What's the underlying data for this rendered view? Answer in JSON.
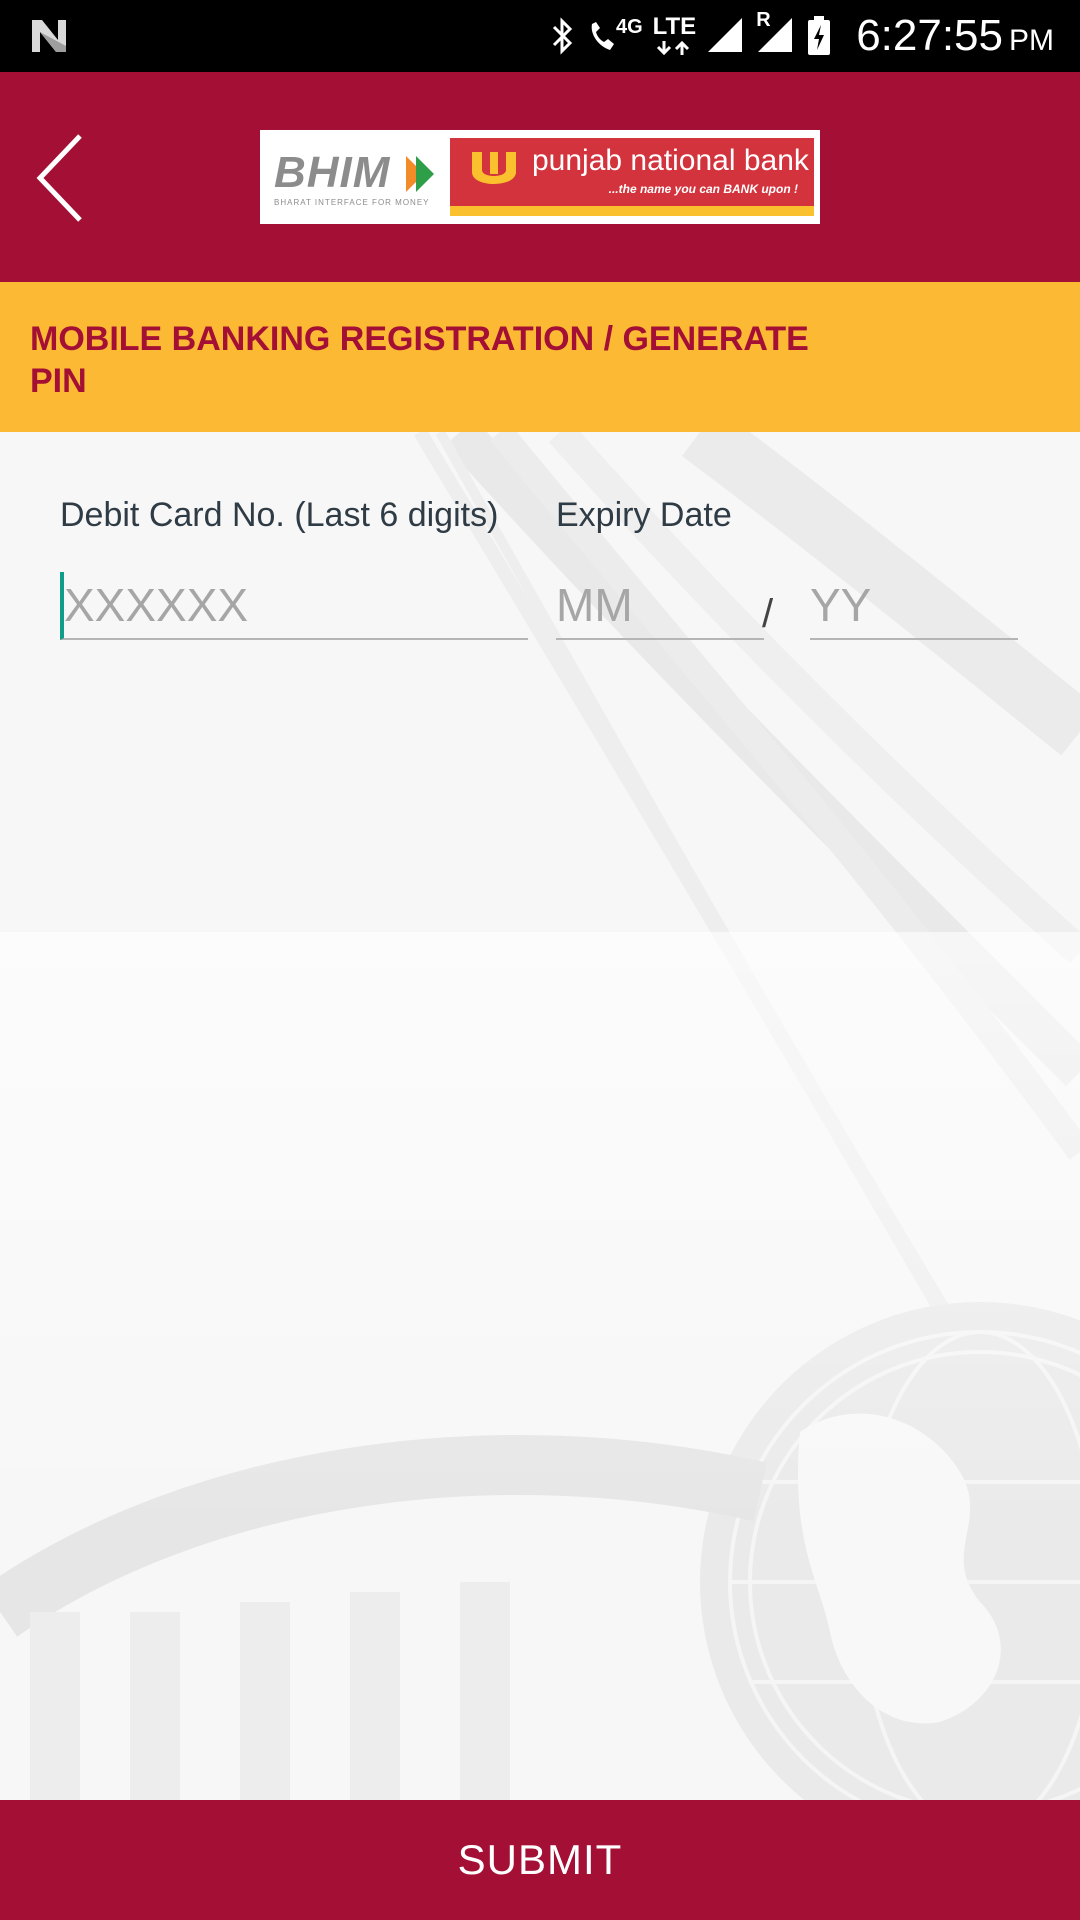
{
  "status_bar": {
    "network_4g": "4G",
    "network_lte": "LTE",
    "roaming": "R",
    "time": "6:27:55",
    "ampm": "PM"
  },
  "header": {
    "bhim_logo_text": "BHIM",
    "bhim_tagline": "BHARAT INTERFACE FOR MONEY",
    "bank_name": "punjab national bank",
    "bank_tagline": "...the name you can BANK upon !",
    "brand_color": "#a30f35",
    "accent_color": "#fbb934"
  },
  "page": {
    "title": "MOBILE BANKING REGISTRATION / GENERATE PIN"
  },
  "form": {
    "debit_card_label": "Debit Card No. (Last 6 digits)",
    "debit_card_placeholder": "XXXXXX",
    "debit_card_value": "",
    "expiry_label": "Expiry Date",
    "month_placeholder": "MM",
    "month_value": "",
    "separator": "/",
    "year_placeholder": "YY",
    "year_value": ""
  },
  "footer": {
    "submit_label": "SUBMIT"
  }
}
